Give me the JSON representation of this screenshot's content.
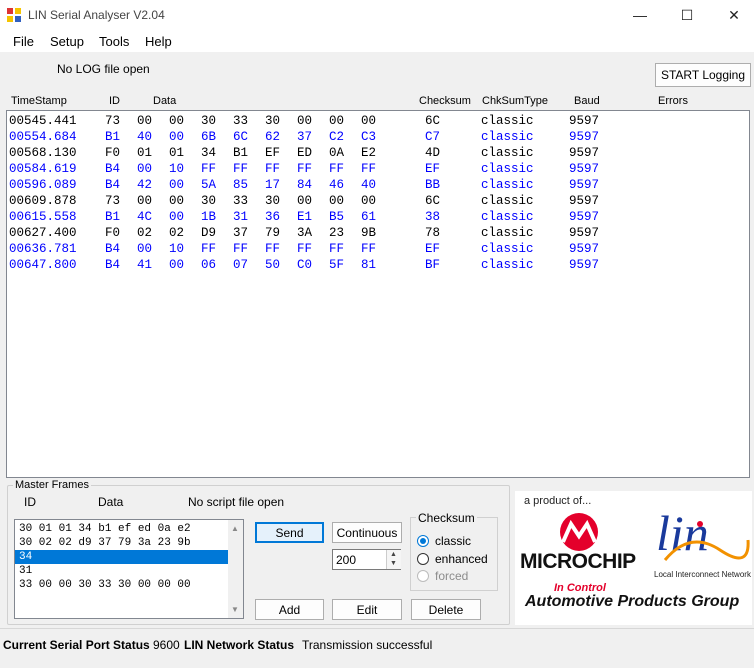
{
  "window": {
    "title": "LIN Serial Analyser V2.04",
    "minimize": "—",
    "maximize": "☐",
    "close": "✕"
  },
  "menu": [
    "File",
    "Setup",
    "Tools",
    "Help"
  ],
  "log": {
    "status": "No LOG file open",
    "start_button": "START Logging"
  },
  "table": {
    "headers": {
      "timestamp": "TimeStamp",
      "id": "ID",
      "data": "Data",
      "checksum": "Checksum",
      "chksumtype": "ChkSumType",
      "baud": "Baud",
      "errors": "Errors"
    },
    "rows": [
      {
        "ts": "00545.441",
        "id": "73",
        "data": [
          "00",
          "00",
          "30",
          "33",
          "30",
          "00",
          "00",
          "00"
        ],
        "checksum": "6C",
        "type": "classic",
        "baud": "9597",
        "color": "#000000"
      },
      {
        "ts": "00554.684",
        "id": "B1",
        "data": [
          "40",
          "00",
          "6B",
          "6C",
          "62",
          "37",
          "C2",
          "C3"
        ],
        "checksum": "C7",
        "type": "classic",
        "baud": "9597",
        "color": "#0000ff"
      },
      {
        "ts": "00568.130",
        "id": "F0",
        "data": [
          "01",
          "01",
          "34",
          "B1",
          "EF",
          "ED",
          "0A",
          "E2"
        ],
        "checksum": "4D",
        "type": "classic",
        "baud": "9597",
        "color": "#000000"
      },
      {
        "ts": "00584.619",
        "id": "B4",
        "data": [
          "00",
          "10",
          "FF",
          "FF",
          "FF",
          "FF",
          "FF",
          "FF"
        ],
        "checksum": "EF",
        "type": "classic",
        "baud": "9597",
        "color": "#0000ff"
      },
      {
        "ts": "00596.089",
        "id": "B4",
        "data": [
          "42",
          "00",
          "5A",
          "85",
          "17",
          "84",
          "46",
          "40"
        ],
        "checksum": "BB",
        "type": "classic",
        "baud": "9597",
        "color": "#0000ff"
      },
      {
        "ts": "00609.878",
        "id": "73",
        "data": [
          "00",
          "00",
          "30",
          "33",
          "30",
          "00",
          "00",
          "00"
        ],
        "checksum": "6C",
        "type": "classic",
        "baud": "9597",
        "color": "#000000"
      },
      {
        "ts": "00615.558",
        "id": "B1",
        "data": [
          "4C",
          "00",
          "1B",
          "31",
          "36",
          "E1",
          "B5",
          "61"
        ],
        "checksum": "38",
        "type": "classic",
        "baud": "9597",
        "color": "#0000ff"
      },
      {
        "ts": "00627.400",
        "id": "F0",
        "data": [
          "02",
          "02",
          "D9",
          "37",
          "79",
          "3A",
          "23",
          "9B"
        ],
        "checksum": "78",
        "type": "classic",
        "baud": "9597",
        "color": "#000000"
      },
      {
        "ts": "00636.781",
        "id": "B4",
        "data": [
          "00",
          "10",
          "FF",
          "FF",
          "FF",
          "FF",
          "FF",
          "FF"
        ],
        "checksum": "EF",
        "type": "classic",
        "baud": "9597",
        "color": "#0000ff"
      },
      {
        "ts": "00647.800",
        "id": "B4",
        "data": [
          "41",
          "00",
          "06",
          "07",
          "50",
          "C0",
          "5F",
          "81"
        ],
        "checksum": "BF",
        "type": "classic",
        "baud": "9597",
        "color": "#0000ff"
      }
    ]
  },
  "master": {
    "legend": "Master Frames",
    "id_label": "ID",
    "data_label": "Data",
    "script_status": "No script file open",
    "frames": [
      "30 01 01 34 b1 ef ed 0a e2",
      "30 02 02 d9 37 79 3a 23 9b",
      "34",
      "31",
      "33 00 00 30 33 30 00 00 00"
    ],
    "selected_index": 2,
    "send": "Send",
    "continuous": "Continuous",
    "interval": "200",
    "add": "Add",
    "edit": "Edit",
    "delete": "Delete"
  },
  "checksum": {
    "legend": "Checksum",
    "options": [
      {
        "label": "classic",
        "checked": true,
        "enabled": true
      },
      {
        "label": "enhanced",
        "checked": false,
        "enabled": true
      },
      {
        "label": "forced",
        "checked": false,
        "enabled": false
      }
    ]
  },
  "branding": {
    "product_of": "a product of...",
    "microchip": "MICROCHIP",
    "lin": "lin",
    "lin_caption": "Local Interconnect Network",
    "in_control": "In Control",
    "group": "Automotive Products Group"
  },
  "status": {
    "port_label": "Current Serial Port Status",
    "port_value": "9600",
    "lin_label": "LIN Network Status",
    "lin_value": "Transmission successful"
  },
  "colors": {
    "accent": "#0078d7",
    "microchip_red": "#e4002b",
    "lin_blue": "#1a3a9c",
    "lin_orange": "#f29100"
  }
}
